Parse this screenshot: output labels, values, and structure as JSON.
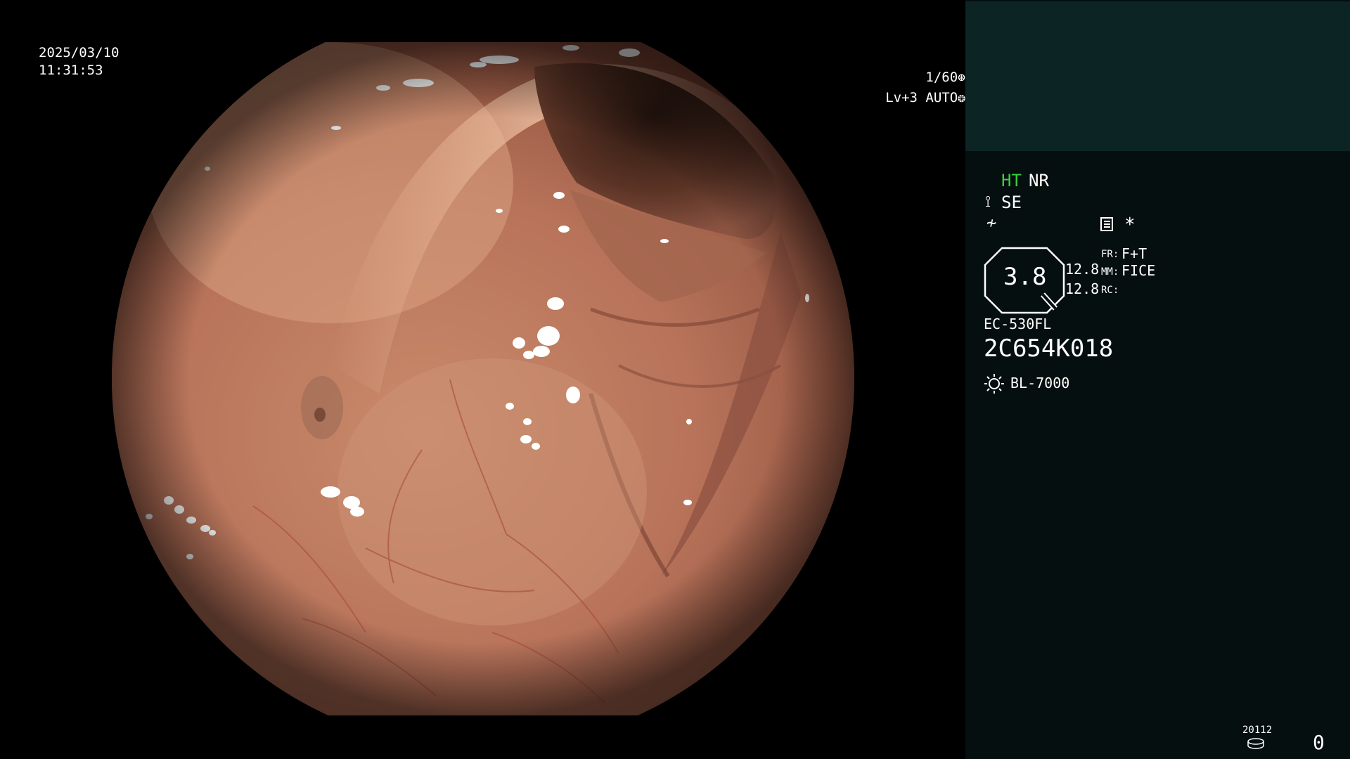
{
  "overlay": {
    "date": "2025/03/10",
    "time": "11:31:53",
    "shutter": "1/60",
    "shutter_icon": "shutter-icon",
    "level": "Lv+3 AUTO",
    "iris_icon": "iris-icon"
  },
  "panel": {
    "ht": "HT",
    "nr": "NR",
    "se_icon": "brush-icon",
    "se": "SE",
    "f_icon": "≁",
    "menu_icon": "menu-icon",
    "asterisk": "*",
    "zoom": "3.8",
    "value_a": "12.8",
    "value_b": "12.8",
    "fr_label": "FR:",
    "fr_value": "F+T",
    "mm_label": "MM:",
    "mm_value": "FICE",
    "rc_label": "RC:",
    "scope_model": "EC-530FL",
    "scope_serial": "2C654K018",
    "light_icon": "sun-icon",
    "light_source": "BL-7000",
    "storage_count": "20112",
    "storage_icon": "disk-icon",
    "counter": "0"
  },
  "colors": {
    "ht_green": "#3ccf3c",
    "panel_bg": "#060f0f",
    "capture_bg": "#0c2424"
  }
}
